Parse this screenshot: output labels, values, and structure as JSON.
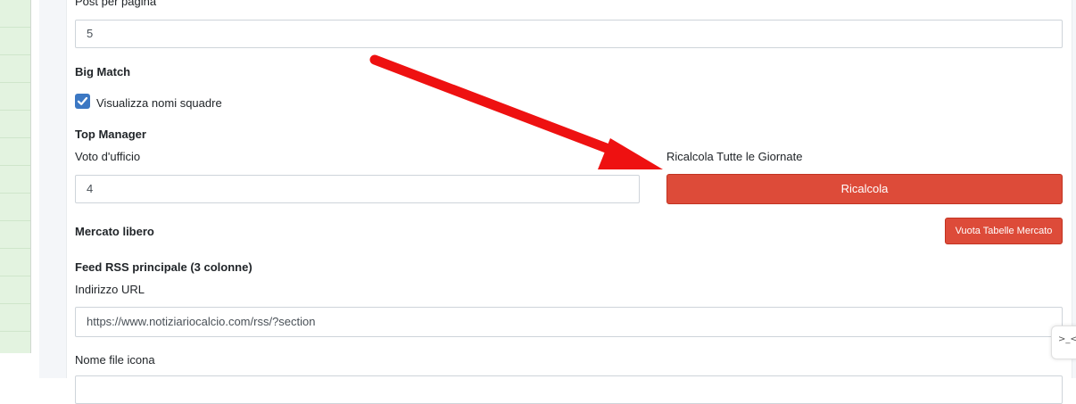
{
  "post_per_pagina": {
    "label": "Post per pagina",
    "value": "5"
  },
  "big_match": {
    "heading": "Big Match",
    "checkbox_label": "Visualizza nomi squadre",
    "checked": true
  },
  "top_manager": {
    "heading": "Top Manager",
    "voto_label": "Voto d'ufficio",
    "voto_value": "4",
    "ricalcola_label": "Ricalcola Tutte le Giornate",
    "ricalcola_button": "Ricalcola"
  },
  "mercato": {
    "heading": "Mercato libero",
    "button": "Vuota Tabelle Mercato"
  },
  "feed_rss": {
    "heading": "Feed RSS principale (3 colonne)",
    "url_label": "Indirizzo URL",
    "url_value": "https://www.notiziariocalcio.com/rss/?section",
    "icon_label": "Nome file icona"
  },
  "colors": {
    "accent_red": "#dd4b39",
    "checkbox_blue": "#3c78c3",
    "annotation_arrow": "#ee1111"
  },
  "icons": {
    "checkbox": "check-icon",
    "annotation": "arrow-annotation-icon"
  }
}
